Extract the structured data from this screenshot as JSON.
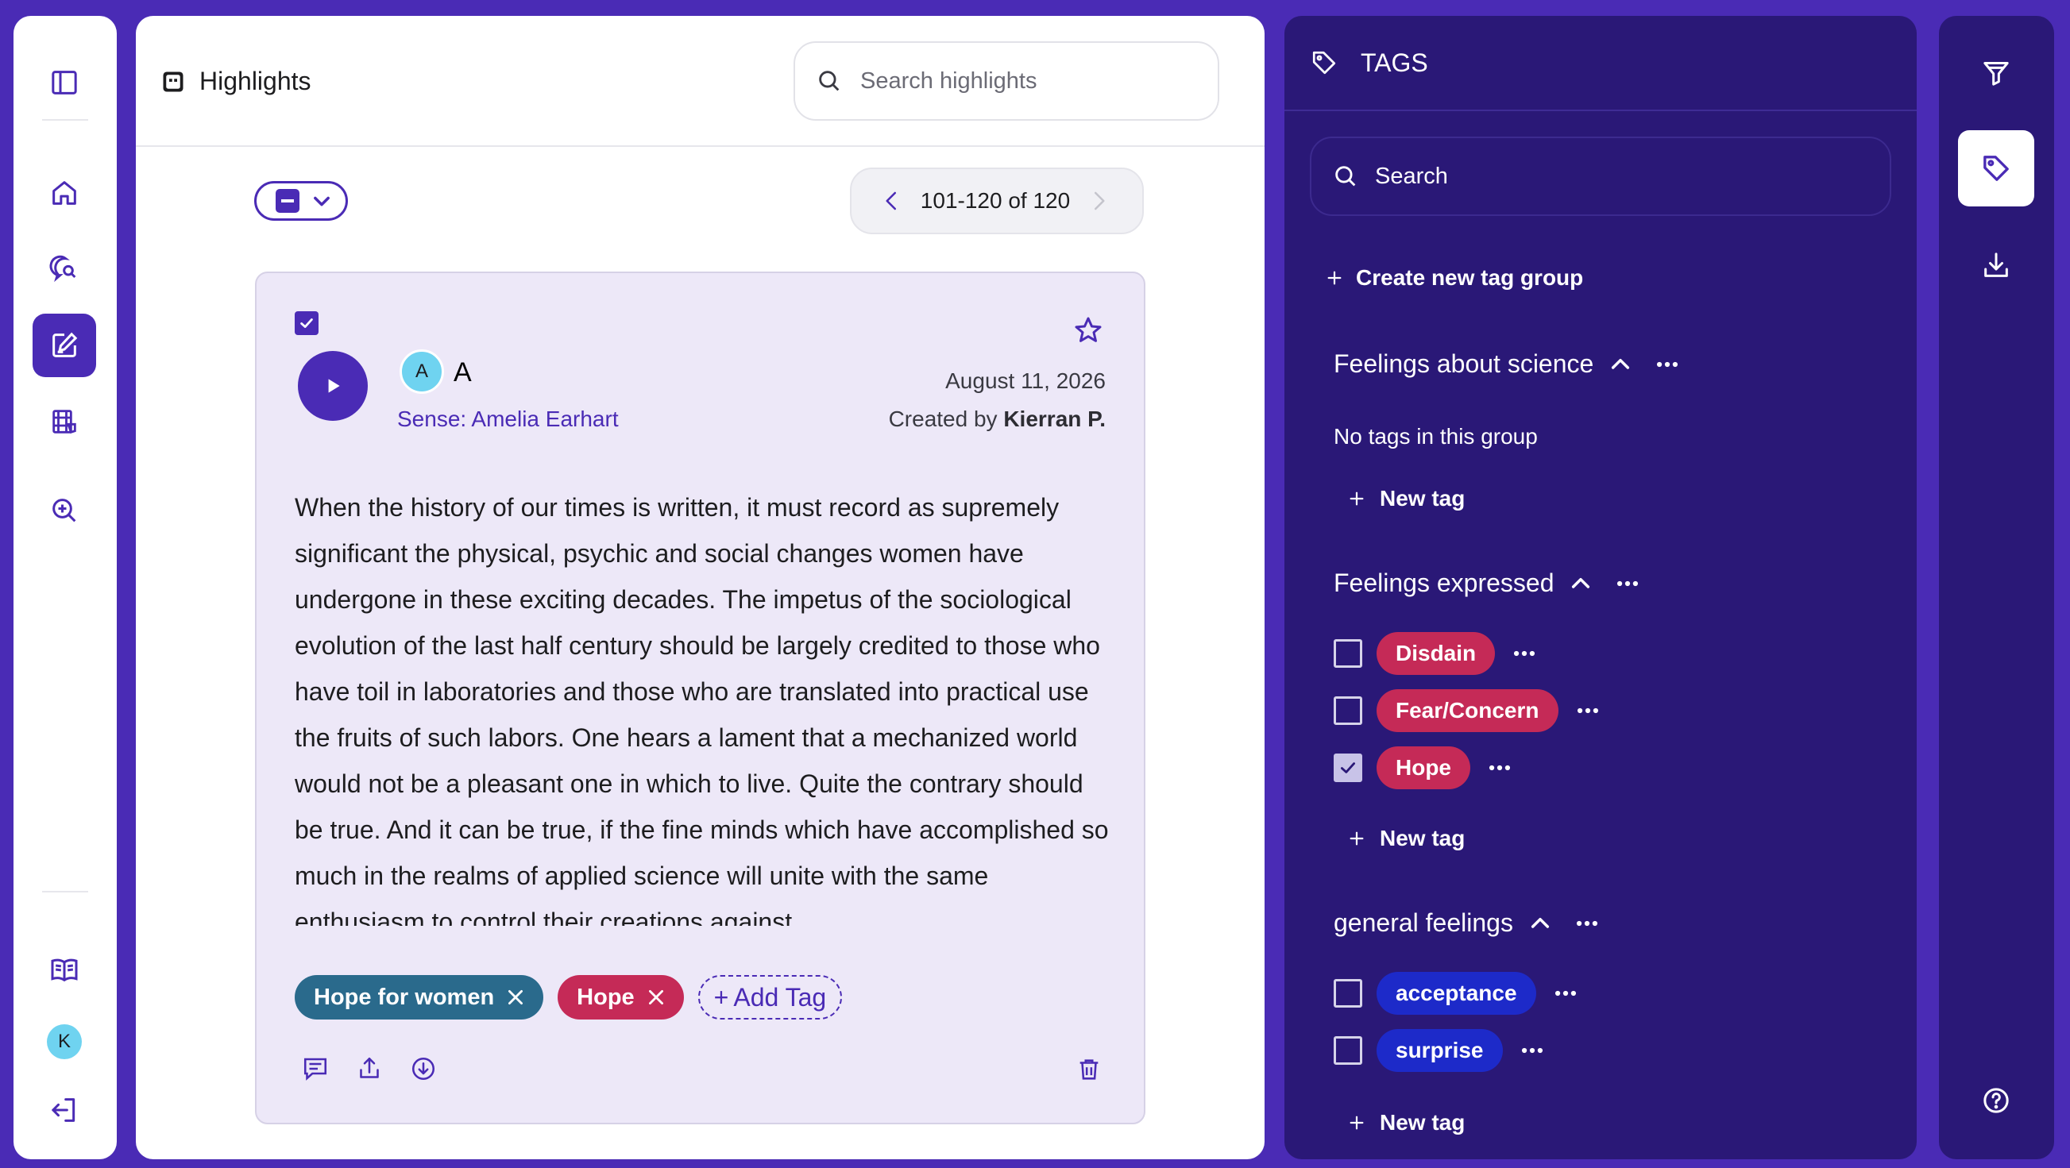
{
  "colors": {
    "background": "#4a2bb5",
    "primary": "#4a2bb5",
    "tag_panel": "#2a1877",
    "card_bg": "#ede8f8",
    "tag_red": "#c52a57",
    "tag_teal": "#2a6a8c",
    "tag_blue": "#1d2ac9"
  },
  "left_nav": {
    "items": [
      {
        "icon": "sidebar-toggle-icon"
      },
      {
        "icon": "home-icon"
      },
      {
        "icon": "chat-search-icon"
      },
      {
        "icon": "highlights-edit-icon",
        "active": true
      },
      {
        "icon": "film-tag-icon"
      },
      {
        "icon": "zoom-in-icon"
      }
    ],
    "bottom": [
      {
        "icon": "book-icon"
      },
      {
        "icon": "avatar",
        "initial": "K"
      },
      {
        "icon": "logout-icon"
      }
    ]
  },
  "header": {
    "title": "Highlights",
    "title_icon": "highlights-icon",
    "search_placeholder": "Search highlights"
  },
  "toolbar": {
    "pagination": "101-120 of 120"
  },
  "card": {
    "checked": true,
    "starred": false,
    "speaker_initial": "A",
    "speaker_name": "A",
    "sense": "Sense: Amelia Earhart",
    "date": "August 11, 2026",
    "created_by_prefix": "Created by",
    "created_by_name": "Kierran P.",
    "body": "When the history of our times is written, it must record as supremely significant the physical, psychic and social changes women have undergone in these exciting decades. The impetus of the sociological evolution of the last half century should be largely credited to those who have toil in laboratories and those who are translated into practical use the fruits of such labors. One hears a lament that a mechanized world would not be a pleasant one in which to live. Quite the contrary should be true. And it can be true, if the fine minds which have accomplished so much in the realms of applied science will unite with the same enthusiasm to control their creations against",
    "tags": [
      {
        "label": "Hope for women",
        "color": "teal"
      },
      {
        "label": "Hope",
        "color": "red"
      }
    ],
    "add_tag_label": "Add Tag"
  },
  "tags_panel": {
    "title": "TAGS",
    "search_placeholder": "Search",
    "create_group_label": "Create new tag group",
    "groups": [
      {
        "name": "Feelings about science",
        "empty_text": "No tags in this group",
        "new_tag_label": "New tag",
        "tags": []
      },
      {
        "name": "Feelings expressed",
        "new_tag_label": "New tag",
        "tags": [
          {
            "label": "Disdain",
            "checked": false,
            "color": "red"
          },
          {
            "label": "Fear/Concern",
            "checked": false,
            "color": "red"
          },
          {
            "label": "Hope",
            "checked": true,
            "color": "red"
          }
        ]
      },
      {
        "name": "general feelings",
        "new_tag_label": "New tag",
        "tags": [
          {
            "label": "acceptance",
            "checked": false,
            "color": "blue"
          },
          {
            "label": "surprise",
            "checked": false,
            "color": "blue"
          }
        ]
      }
    ]
  },
  "right_rail": {
    "items": [
      {
        "icon": "filter-icon"
      },
      {
        "icon": "tag-icon",
        "active": true
      },
      {
        "icon": "download-icon"
      },
      {
        "icon": "help-icon"
      }
    ]
  }
}
